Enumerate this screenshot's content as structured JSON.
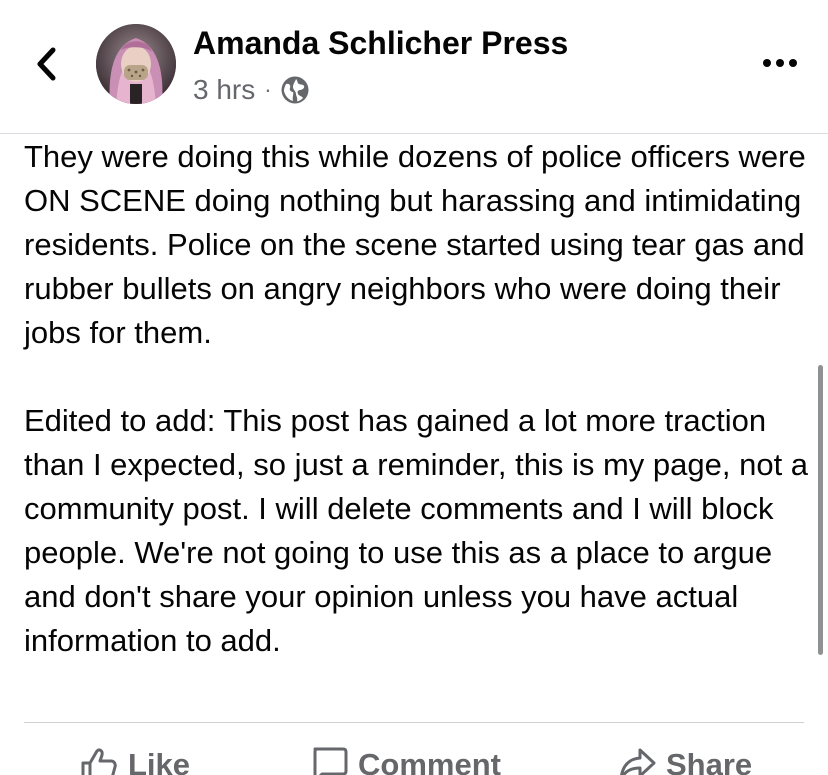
{
  "header": {
    "author_name": "Amanda Schlicher Press",
    "timestamp": "3 hrs",
    "separator": "·",
    "audience_icon": "globe-icon",
    "back_icon": "chevron-left-icon",
    "more_icon": "more-dots-icon"
  },
  "post": {
    "paragraphs": [
      "They were doing this while dozens of police officers were ON SCENE doing nothing but harassing and intimidating residents. Police on the scene started using tear gas and rubber bullets on angry neighbors who were doing their jobs for them.",
      "Edited to add: This post has gained a lot more traction than I expected, so just a reminder, this is my page, not a community post. I will delete comments and I will block people. We're not going to use this as a place to argue and don't share your opinion unless you have actual information to add."
    ]
  },
  "actions": {
    "like_label": "Like",
    "comment_label": "Comment",
    "share_label": "Share"
  },
  "colors": {
    "text_primary": "#050505",
    "text_secondary": "#65676b",
    "divider": "#ced0d4",
    "background": "#ffffff"
  }
}
